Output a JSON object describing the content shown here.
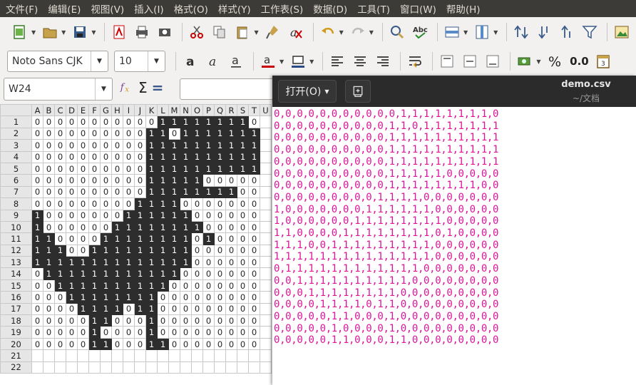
{
  "menubar": [
    "文件(F)",
    "编辑(E)",
    "视图(V)",
    "插入(I)",
    "格式(O)",
    "样式(Y)",
    "工作表(S)",
    "数据(D)",
    "工具(T)",
    "窗口(W)",
    "帮助(H)"
  ],
  "toolbar": {
    "font_name": "Noto Sans CJK",
    "font_size": "10",
    "number_format_label": "0.0"
  },
  "formula_bar": {
    "cell_ref": "W24",
    "content": ""
  },
  "sheet": {
    "columns": [
      "A",
      "B",
      "C",
      "D",
      "E",
      "F",
      "G",
      "H",
      "I",
      "J",
      "K",
      "L",
      "M",
      "N",
      "O",
      "P",
      "Q",
      "R",
      "S",
      "T",
      "U"
    ],
    "row_numbers": [
      "1",
      "2",
      "3",
      "4",
      "5",
      "6",
      "7",
      "8",
      "9",
      "10",
      "11",
      "12",
      "13",
      "14",
      "15",
      "16",
      "17",
      "18",
      "19",
      "20",
      "21",
      "22"
    ],
    "rows": [
      [
        0,
        0,
        0,
        0,
        0,
        0,
        0,
        0,
        0,
        0,
        0,
        1,
        1,
        1,
        1,
        1,
        1,
        1,
        1,
        0
      ],
      [
        0,
        0,
        0,
        0,
        0,
        0,
        0,
        0,
        0,
        0,
        1,
        1,
        0,
        1,
        1,
        1,
        1,
        1,
        1,
        1
      ],
      [
        0,
        0,
        0,
        0,
        0,
        0,
        0,
        0,
        0,
        0,
        1,
        1,
        1,
        1,
        1,
        1,
        1,
        1,
        1,
        1
      ],
      [
        0,
        0,
        0,
        0,
        0,
        0,
        0,
        0,
        0,
        0,
        1,
        1,
        1,
        1,
        1,
        1,
        1,
        1,
        1,
        1
      ],
      [
        0,
        0,
        0,
        0,
        0,
        0,
        0,
        0,
        0,
        0,
        1,
        1,
        1,
        1,
        1,
        1,
        1,
        1,
        1,
        1
      ],
      [
        0,
        0,
        0,
        0,
        0,
        0,
        0,
        0,
        0,
        0,
        1,
        1,
        1,
        1,
        1,
        0,
        0,
        0,
        0,
        0
      ],
      [
        0,
        0,
        0,
        0,
        0,
        0,
        0,
        0,
        0,
        0,
        1,
        1,
        1,
        1,
        1,
        1,
        1,
        1,
        0,
        0
      ],
      [
        0,
        0,
        0,
        0,
        0,
        0,
        0,
        0,
        0,
        1,
        1,
        1,
        1,
        0,
        0,
        0,
        0,
        0,
        0,
        0
      ],
      [
        1,
        0,
        0,
        0,
        0,
        0,
        0,
        0,
        1,
        1,
        1,
        1,
        1,
        1,
        0,
        0,
        0,
        0,
        0,
        0
      ],
      [
        1,
        0,
        0,
        0,
        0,
        0,
        0,
        1,
        1,
        1,
        1,
        1,
        1,
        1,
        1,
        0,
        0,
        0,
        0,
        0
      ],
      [
        1,
        1,
        0,
        0,
        0,
        0,
        1,
        1,
        1,
        1,
        1,
        1,
        1,
        1,
        0,
        1,
        0,
        0,
        0,
        0
      ],
      [
        1,
        1,
        1,
        0,
        0,
        1,
        1,
        1,
        1,
        1,
        1,
        1,
        1,
        1,
        0,
        0,
        0,
        0,
        0,
        0
      ],
      [
        1,
        1,
        1,
        1,
        1,
        1,
        1,
        1,
        1,
        1,
        1,
        1,
        1,
        1,
        0,
        0,
        0,
        0,
        0,
        0
      ],
      [
        0,
        1,
        1,
        1,
        1,
        1,
        1,
        1,
        1,
        1,
        1,
        1,
        1,
        0,
        0,
        0,
        0,
        0,
        0,
        0
      ],
      [
        0,
        0,
        1,
        1,
        1,
        1,
        1,
        1,
        1,
        1,
        1,
        1,
        0,
        0,
        0,
        0,
        0,
        0,
        0,
        0
      ],
      [
        0,
        0,
        0,
        1,
        1,
        1,
        1,
        1,
        1,
        1,
        1,
        0,
        0,
        0,
        0,
        0,
        0,
        0,
        0,
        0
      ],
      [
        0,
        0,
        0,
        0,
        1,
        1,
        1,
        1,
        0,
        1,
        1,
        0,
        0,
        0,
        0,
        0,
        0,
        0,
        0,
        0
      ],
      [
        0,
        0,
        0,
        0,
        0,
        1,
        1,
        0,
        0,
        0,
        1,
        0,
        0,
        0,
        0,
        0,
        0,
        0,
        0,
        0
      ],
      [
        0,
        0,
        0,
        0,
        0,
        1,
        0,
        0,
        0,
        0,
        1,
        0,
        0,
        0,
        0,
        0,
        0,
        0,
        0,
        0
      ],
      [
        0,
        0,
        0,
        0,
        0,
        1,
        1,
        0,
        0,
        0,
        1,
        1,
        0,
        0,
        0,
        0,
        0,
        0,
        0,
        0
      ]
    ]
  },
  "editor": {
    "open_label": "打开(O)",
    "title": "demo.csv",
    "subtitle": "~/文档",
    "lines": [
      "0,0,0,0,0,0,0,0,0,0,0,1,1,1,1,1,1,1,1,0",
      "0,0,0,0,0,0,0,0,0,0,1,1,0,1,1,1,1,1,1,1",
      "0,0,0,0,0,0,0,0,0,0,1,1,1,1,1,1,1,1,1,1",
      "0,0,0,0,0,0,0,0,0,0,1,1,1,1,1,1,1,1,1,1",
      "0,0,0,0,0,0,0,0,0,0,1,1,1,1,1,1,1,1,1,1",
      "0,0,0,0,0,0,0,0,0,0,1,1,1,1,1,0,0,0,0,0",
      "0,0,0,0,0,0,0,0,0,0,1,1,1,1,1,1,1,1,0,0",
      "0,0,0,0,0,0,0,0,0,1,1,1,1,0,0,0,0,0,0,0",
      "1,0,0,0,0,0,0,0,1,1,1,1,1,1,0,0,0,0,0,0",
      "1,0,0,0,0,0,0,1,1,1,1,1,1,1,1,0,0,0,0,0",
      "1,1,0,0,0,0,1,1,1,1,1,1,1,1,0,1,0,0,0,0",
      "1,1,1,0,0,1,1,1,1,1,1,1,1,1,0,0,0,0,0,0",
      "1,1,1,1,1,1,1,1,1,1,1,1,1,1,0,0,0,0,0,0",
      "0,1,1,1,1,1,1,1,1,1,1,1,1,0,0,0,0,0,0,0",
      "0,0,1,1,1,1,1,1,1,1,1,1,0,0,0,0,0,0,0,0",
      "0,0,0,1,1,1,1,1,1,1,1,0,0,0,0,0,0,0,0,0",
      "0,0,0,0,1,1,1,1,0,1,1,0,0,0,0,0,0,0,0,0",
      "0,0,0,0,0,1,1,0,0,0,1,0,0,0,0,0,0,0,0,0",
      "0,0,0,0,0,1,0,0,0,0,1,0,0,0,0,0,0,0,0,0",
      "0,0,0,0,0,1,1,0,0,0,1,1,0,0,0,0,0,0,0,0"
    ]
  },
  "colors": {
    "filled_cell": "#2d2d2d",
    "editor_text": "#e0149b",
    "menubar_bg": "#3c3b37"
  }
}
